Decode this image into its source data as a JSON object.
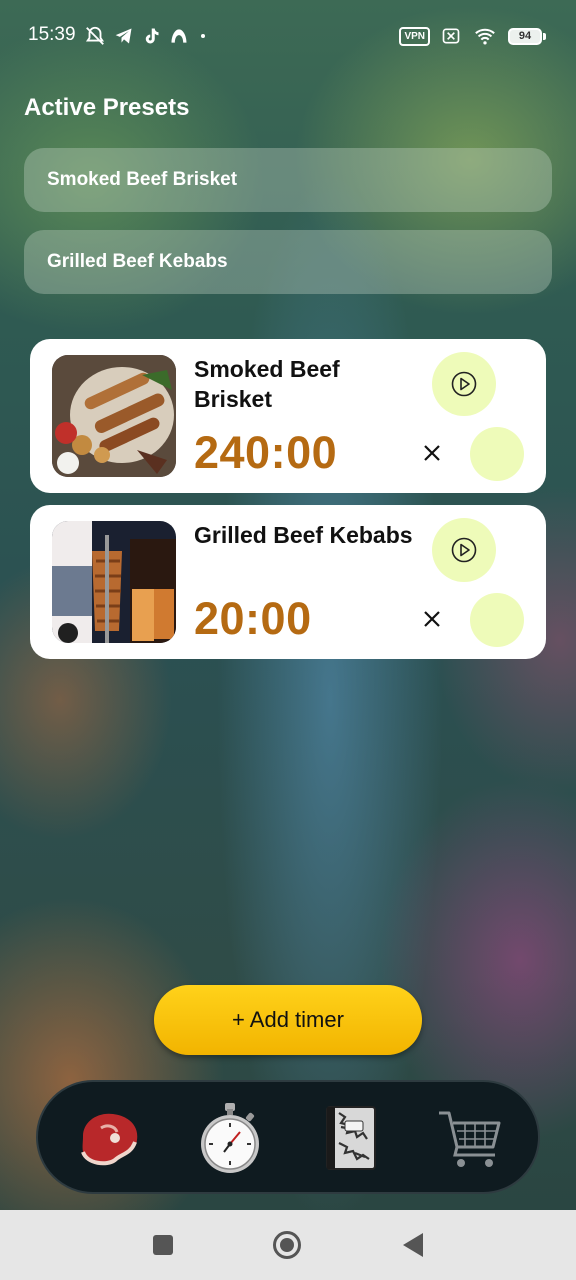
{
  "status_bar": {
    "time": "15:39",
    "vpn_label": "VPN",
    "battery_level": "94",
    "left_icons": [
      "mute-icon",
      "telegram-icon",
      "tiktok-icon",
      "app-icon",
      "dot-icon"
    ],
    "right_icons": [
      "vpn-icon",
      "sim-off-icon",
      "wifi-icon",
      "battery-icon"
    ]
  },
  "section": {
    "title": "Active Presets"
  },
  "presets": [
    {
      "label": "Smoked Beef Brisket"
    },
    {
      "label": "Grilled Beef Kebabs"
    }
  ],
  "timers": [
    {
      "title": "Smoked Beef Brisket",
      "time": "240:00",
      "image": "grilled-meat-platter"
    },
    {
      "title": "Grilled Beef Kebabs",
      "time": "20:00",
      "image": "doner-kebab-spit"
    }
  ],
  "add_button": {
    "label": "+ Add timer"
  },
  "bottom_nav": {
    "items": [
      {
        "name": "steak-icon"
      },
      {
        "name": "stopwatch-icon"
      },
      {
        "name": "recipe-book-icon"
      },
      {
        "name": "shopping-cart-icon"
      }
    ]
  },
  "colors": {
    "accent_yellow": "#f2b400",
    "timer_text": "#b56a12",
    "button_bg": "#eefbb9",
    "nav_bg": "#0f1b20"
  }
}
